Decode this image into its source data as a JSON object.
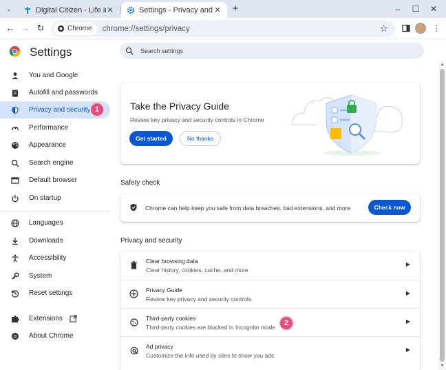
{
  "tabs": [
    {
      "title": "Digital Citizen - Life in a digital",
      "close": "✕"
    },
    {
      "title": "Settings - Privacy and security",
      "close": "✕"
    }
  ],
  "newtab_label": "+",
  "window_controls": {
    "minimize": "–",
    "maximize": "☐",
    "close": "✕"
  },
  "toolbar": {
    "chip_label": "Chrome",
    "url": "chrome://settings/privacy"
  },
  "settings": {
    "title": "Settings",
    "search_placeholder": "Search settings"
  },
  "sidebar": {
    "items": [
      {
        "label": "You and Google",
        "icon": "person-icon"
      },
      {
        "label": "Autofill and passwords",
        "icon": "clipboard-icon"
      },
      {
        "label": "Privacy and security",
        "icon": "shield-icon",
        "active": true
      },
      {
        "label": "Performance",
        "icon": "gauge-icon"
      },
      {
        "label": "Appearance",
        "icon": "palette-icon"
      },
      {
        "label": "Search engine",
        "icon": "search-icon"
      },
      {
        "label": "Default browser",
        "icon": "browser-icon"
      },
      {
        "label": "On startup",
        "icon": "power-icon"
      },
      {
        "label": "Languages",
        "icon": "globe-icon"
      },
      {
        "label": "Downloads",
        "icon": "download-icon"
      },
      {
        "label": "Accessibility",
        "icon": "accessibility-icon"
      },
      {
        "label": "System",
        "icon": "wrench-icon"
      },
      {
        "label": "Reset settings",
        "icon": "history-icon"
      },
      {
        "label": "Extensions",
        "icon": "puzzle-icon"
      },
      {
        "label": "About Chrome",
        "icon": "chrome-icon"
      }
    ]
  },
  "badges": {
    "one": "1",
    "two": "2"
  },
  "privacy_guide": {
    "title": "Take the Privacy Guide",
    "subtitle": "Review key privacy and security controls in Chrome",
    "primary": "Get started",
    "secondary": "No thanks"
  },
  "safety_check": {
    "heading": "Safety check",
    "text": "Chrome can help keep you safe from data breaches, bad extensions, and more",
    "button": "Check now"
  },
  "privacy_section": {
    "heading": "Privacy and security",
    "rows": [
      {
        "title": "Clear browsing data",
        "subtitle": "Clear history, cookies, cache, and more",
        "icon": "trash-icon"
      },
      {
        "title": "Privacy Guide",
        "subtitle": "Review key privacy and security controls",
        "icon": "compass-icon"
      },
      {
        "title": "Third-party cookies",
        "subtitle": "Third-party cookies are blocked in Incognito mode",
        "icon": "cookie-icon"
      },
      {
        "title": "Ad privacy",
        "subtitle": "Customize the info used by sites to show you ads",
        "icon": "ad-privacy-icon"
      }
    ]
  },
  "colors": {
    "accent": "#0b57d0",
    "active_bg": "#d3e3fd",
    "badge": "#de4f7e"
  }
}
